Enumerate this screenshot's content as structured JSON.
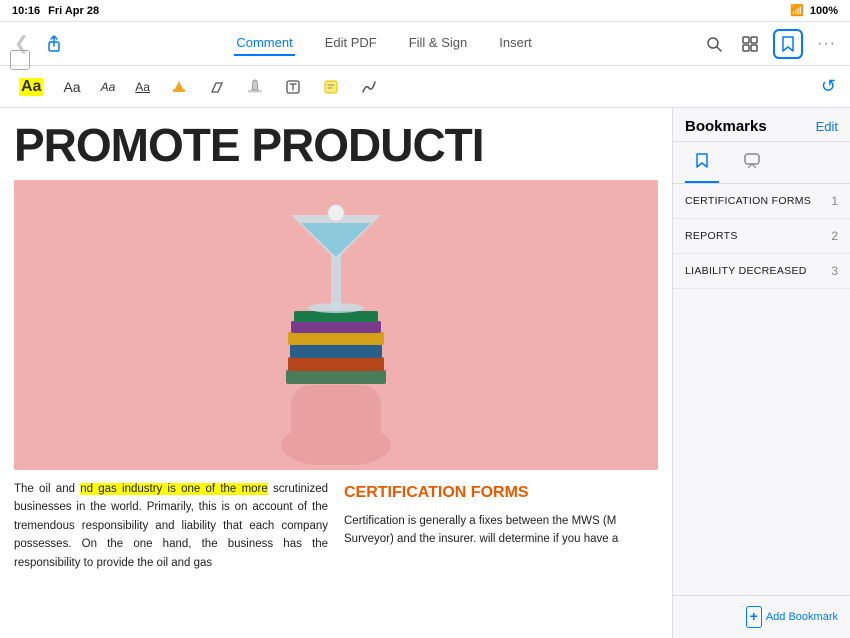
{
  "status_bar": {
    "time": "10:16",
    "date": "Fri Apr 28",
    "wifi": "WiFi",
    "battery": "100%"
  },
  "toolbar": {
    "back_label": "‹",
    "share_label": "↑",
    "tab_comment": "Comment",
    "tab_edit_pdf": "Edit PDF",
    "tab_fill_sign": "Fill & Sign",
    "tab_insert": "Insert",
    "search_label": "⌕",
    "grid_label": "⊞",
    "bookmarks_label": "🔖",
    "more_label": "···"
  },
  "annotation_toolbar": {
    "btn_aa_highlight": "Aa",
    "btn_aa2": "Aa",
    "btn_aa3": "Aa",
    "btn_aa4": "Aa",
    "btn_highlight": "≡",
    "btn_underline": "⊻",
    "btn_strikethrough": "⊘",
    "btn_note": "T",
    "btn_sticky": "◨",
    "btn_freehand": "✎",
    "undo": "↺"
  },
  "pdf": {
    "title": "PROMOTE PRODUCTI",
    "col_left_text": "The oil and gas industry is one of the more scrutinized businesses in the world. Primarily, this is on account of the tremendous responsibility and liability that each company possesses. On the one hand, the business has the responsibility to provide the oil and gas",
    "highlighted_text": "nd gas industry is one of the more",
    "col_right_heading": "CERTIFICATION FORMS",
    "col_right_text": "Certification is generally a fixes between the MWS (M Surveyor) and the insurer. will determine if you have a"
  },
  "bookmarks_panel": {
    "title": "Bookmarks",
    "edit_label": "Edit",
    "tab_bookmark_icon": "🔖",
    "tab_comment_icon": "💬",
    "items": [
      {
        "label": "CERTIFICATION FORMS",
        "number": "1"
      },
      {
        "label": "REPORTS",
        "number": "2"
      },
      {
        "label": "LIABILITY DECREASED",
        "number": "3"
      }
    ],
    "add_bookmark_label": "Add Bookmark"
  }
}
